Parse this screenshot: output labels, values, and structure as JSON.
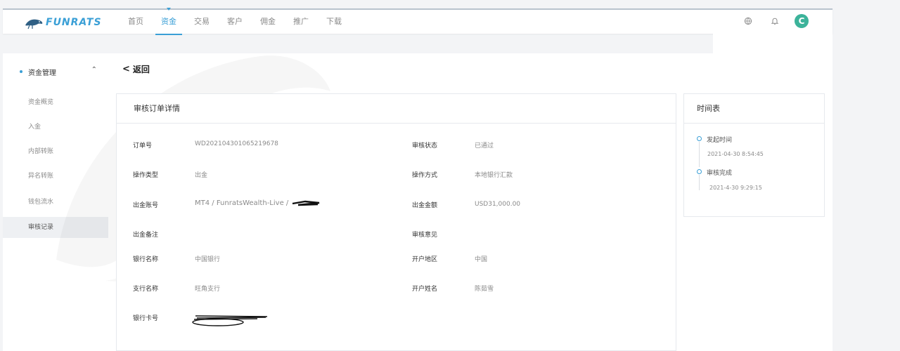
{
  "brand": {
    "name": "FUNRATS",
    "color": "#3a9fd6"
  },
  "nav": {
    "items": [
      {
        "label": "首页",
        "active": false
      },
      {
        "label": "资金",
        "active": true
      },
      {
        "label": "交易",
        "active": false
      },
      {
        "label": "客户",
        "active": false
      },
      {
        "label": "佣金",
        "active": false
      },
      {
        "label": "推广",
        "active": false
      },
      {
        "label": "下载",
        "active": false
      }
    ],
    "icons": [
      "globe-icon",
      "bell-icon"
    ],
    "avatar_initial": "C"
  },
  "sidebar": {
    "section_title": "资金管理",
    "items": [
      {
        "label": "资金概览",
        "active": false
      },
      {
        "label": "入金",
        "active": false
      },
      {
        "label": "内部转账",
        "active": false
      },
      {
        "label": "异名转账",
        "active": false
      },
      {
        "label": "钱包流水",
        "active": false
      },
      {
        "label": "审核记录",
        "active": true
      }
    ]
  },
  "back_label": "返回",
  "detail": {
    "title": "审核订单详情",
    "order_no_label": "订单号",
    "order_no": "WD202104301065219678",
    "status_label": "审核状态",
    "status": "已通过",
    "op_type_label": "操作类型",
    "op_type": "出金",
    "op_method_label": "操作方式",
    "op_method": "本地银行汇款",
    "account_label": "出金账号",
    "account": "MT4 / FunratsWealth-Live /",
    "amount_label": "出金金额",
    "amount": "USD31,000.00",
    "remark_label": "出金备注",
    "remark": "",
    "opinion_label": "审核意见",
    "opinion": "",
    "bank_label": "银行名称",
    "bank": "中国银行",
    "region_label": "开户地区",
    "region": "中国",
    "branch_label": "支行名称",
    "branch": "旺角支行",
    "holder_label": "开户姓名",
    "holder": "陈茹雪",
    "card_label": "银行卡号",
    "card": ""
  },
  "timeline": {
    "title": "时间表",
    "events": [
      {
        "label": "发起时间",
        "time": "2021-04-30  8:54:45"
      },
      {
        "label": "审核完成",
        "time": "2021-4-30  9:29:15"
      }
    ]
  }
}
